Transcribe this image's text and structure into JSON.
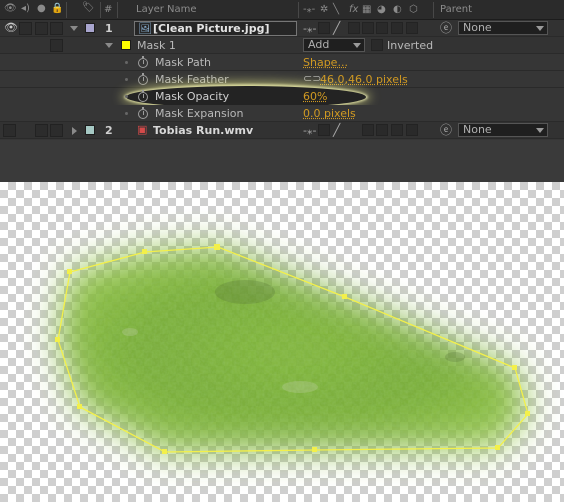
{
  "header": {
    "num": "#",
    "layer_name": "Layer Name",
    "parent": "Parent"
  },
  "layers": [
    {
      "number": "1",
      "name": "[Clean Picture.jpg]",
      "label_color": "#a9a6cf",
      "parent": "None"
    },
    {
      "number": "2",
      "name": "Tobias Run.wmv",
      "label_color": "#a6c9c4",
      "parent": "None"
    }
  ],
  "mask": {
    "name": "Mask 1",
    "color": "#ffff00",
    "mode": "Add",
    "inverted_label": "Inverted",
    "properties": [
      {
        "label": "Mask Path",
        "value": "Shape..."
      },
      {
        "label": "Mask Feather",
        "value": "46.0,46.0 pixels"
      },
      {
        "label": "Mask Opacity",
        "value": "60%"
      },
      {
        "label": "Mask Expansion",
        "value": "0.0 pixels"
      }
    ]
  },
  "icons": {
    "switch_glyphs": "⁂",
    "fx": "fx"
  },
  "colors": {
    "mask_path": "#f3f04a",
    "value_text": "#d19a22",
    "grass_dark": "#5e8a2a",
    "grass_light": "#8ec23c"
  }
}
